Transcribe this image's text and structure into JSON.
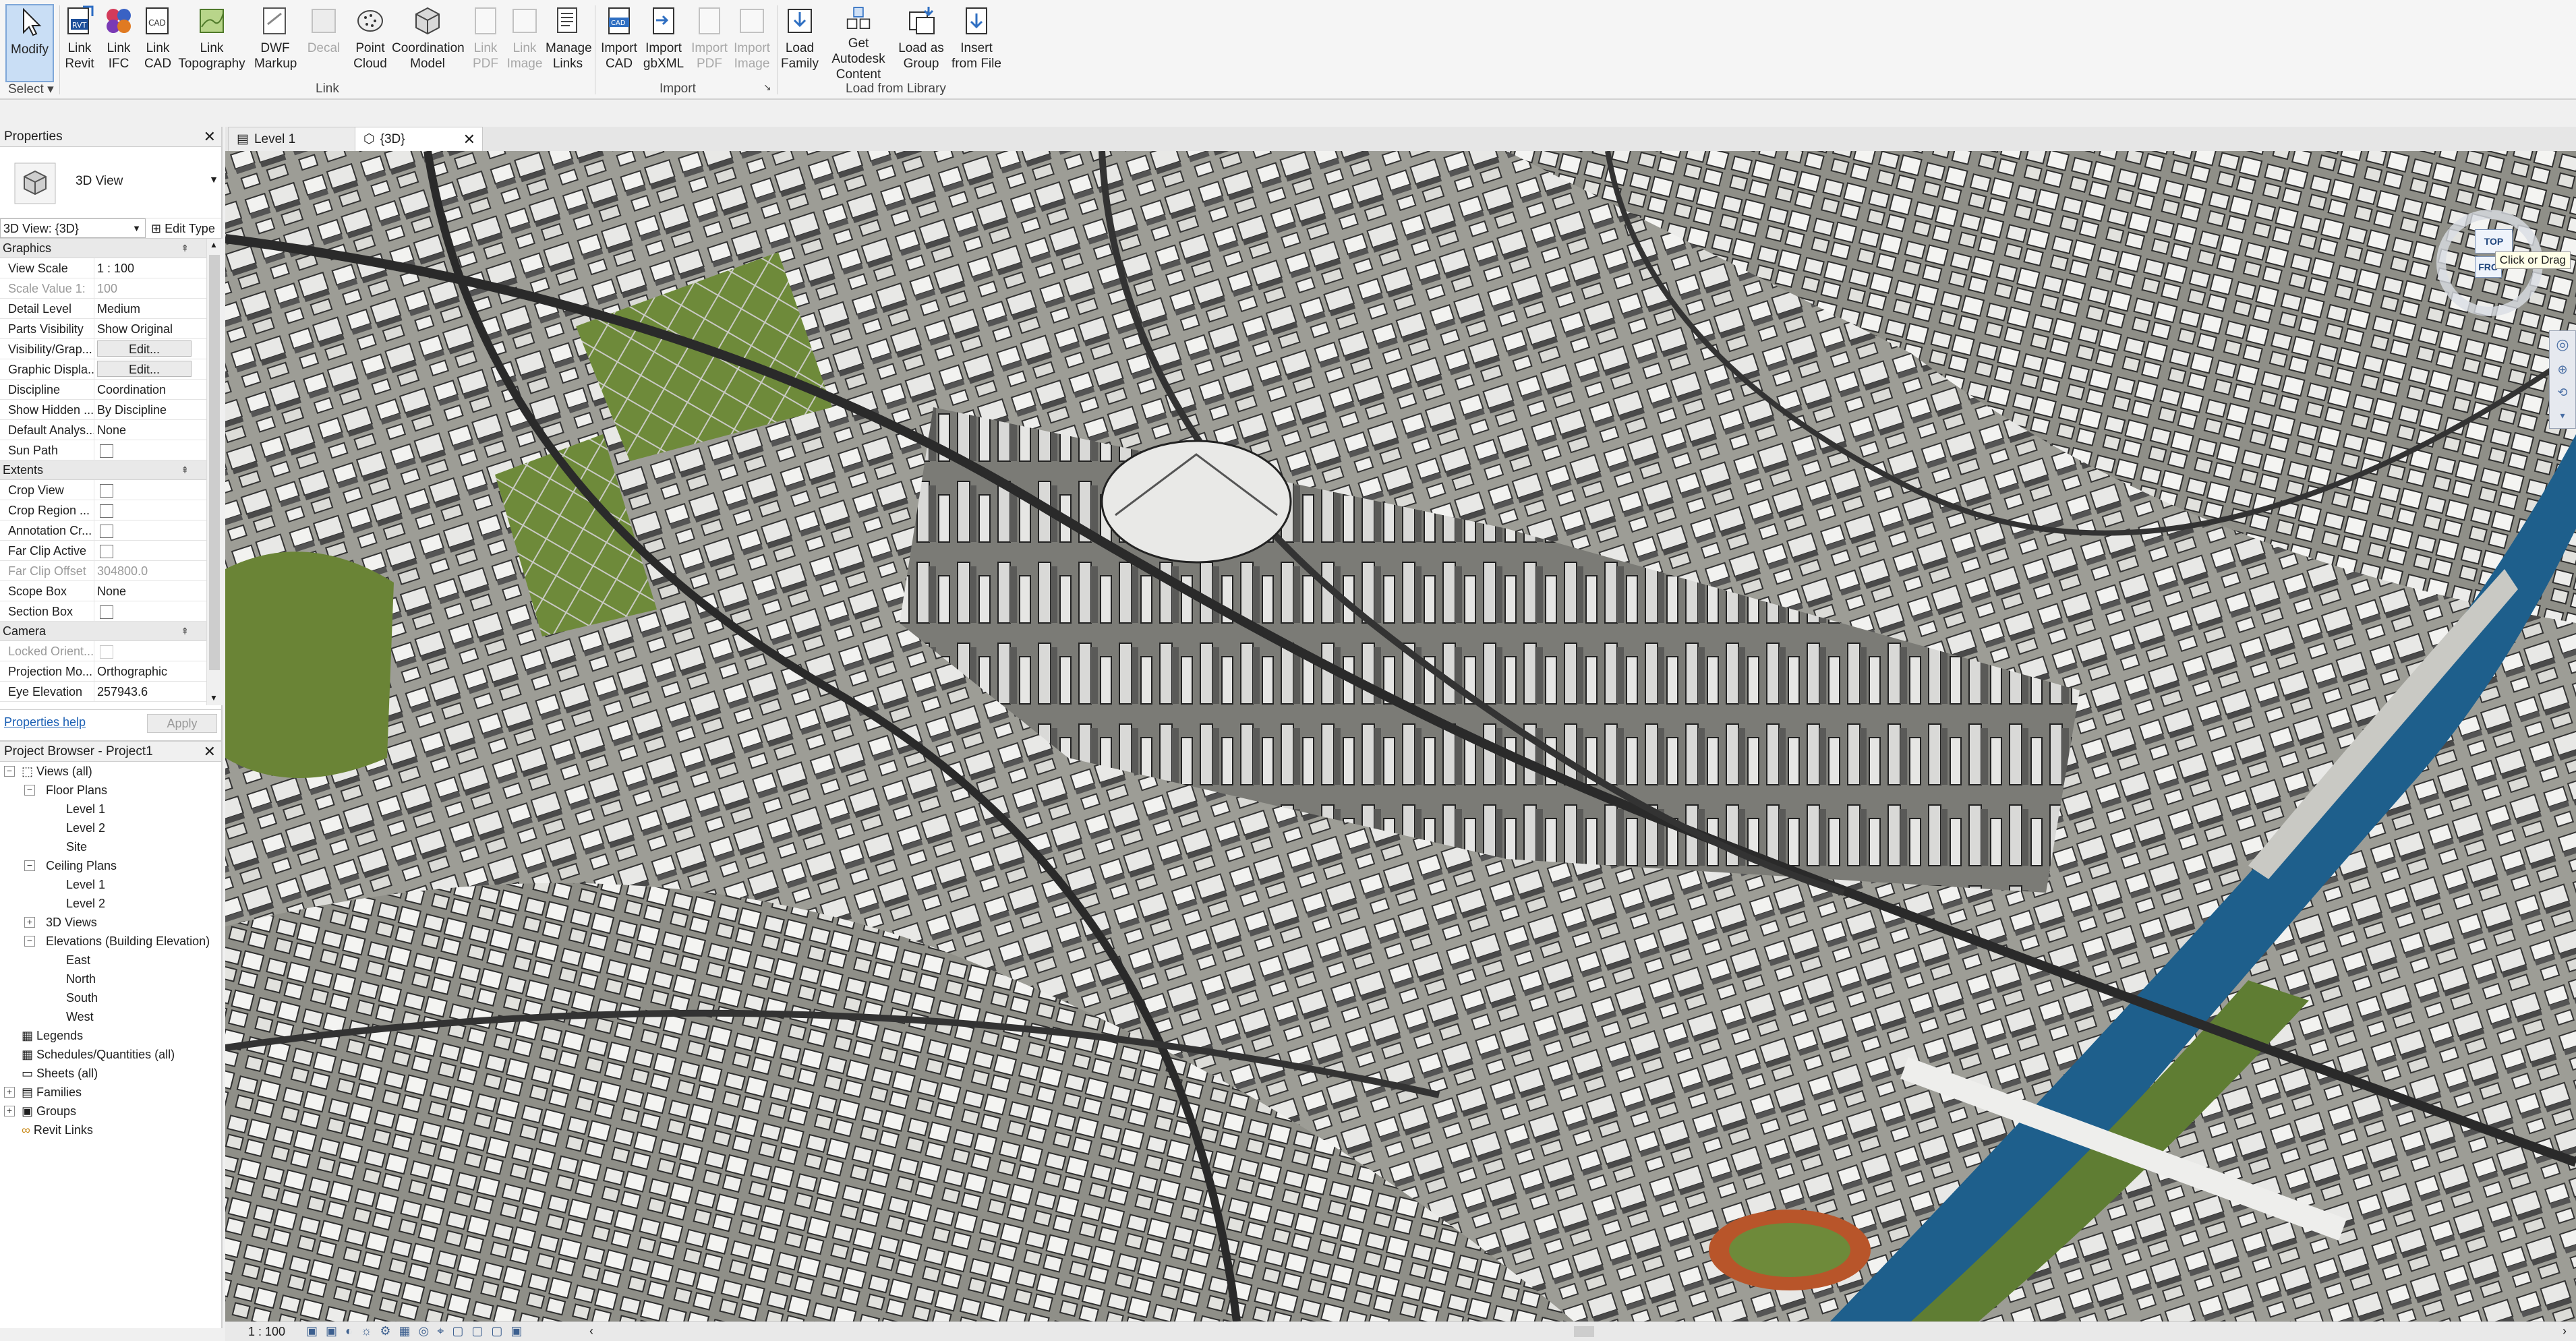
{
  "ribbon": {
    "buttons": {
      "modify": "Modify",
      "link_revit": "Link Revit",
      "link_ifc": "Link IFC",
      "link_cad": "Link CAD",
      "link_topography": "Link Topography",
      "dwf_markup": "DWF Markup",
      "decal": "Decal",
      "point_cloud": "Point Cloud",
      "coordination_model": "Coordination Model",
      "link_pdf": "Link PDF",
      "link_image": "Link Image",
      "manage_links": "Manage Links",
      "import_cad": "Import CAD",
      "import_gbxml": "Import gbXML",
      "import_pdf": "Import PDF",
      "import_image": "Import Image",
      "load_family": "Load Family",
      "get_autodesk_content": "Get Autodesk Content",
      "load_as_group": "Load as Group",
      "insert_from_file": "Insert from File"
    },
    "panels": {
      "select": "Select",
      "link": "Link",
      "import": "Import",
      "load_from_library": "Load from Library"
    }
  },
  "tabs": {
    "level1": "Level 1",
    "view3d": "{3D}"
  },
  "properties": {
    "title": "Properties",
    "type_name": "3D View",
    "instance_selector": "3D View: {3D}",
    "edit_type": "Edit Type",
    "groups": {
      "graphics": "Graphics",
      "extents": "Extents",
      "camera": "Camera"
    },
    "graphics": {
      "view_scale_k": "View Scale",
      "view_scale_v": "1 : 100",
      "scale_value_k": "Scale Value    1:",
      "scale_value_v": "100",
      "detail_level_k": "Detail Level",
      "detail_level_v": "Medium",
      "parts_visibility_k": "Parts Visibility",
      "parts_visibility_v": "Show Original",
      "vg_k": "Visibility/Grap...",
      "vg_v": "Edit...",
      "gd_k": "Graphic Displa...",
      "gd_v": "Edit...",
      "discipline_k": "Discipline",
      "discipline_v": "Coordination",
      "show_hidden_k": "Show Hidden ...",
      "show_hidden_v": "By Discipline",
      "default_analysis_k": "Default Analys...",
      "default_analysis_v": "None",
      "sun_path_k": "Sun Path"
    },
    "extents": {
      "crop_view_k": "Crop View",
      "crop_region_k": "Crop Region ...",
      "annotation_crop_k": "Annotation Cr...",
      "far_clip_active_k": "Far Clip Active",
      "far_clip_offset_k": "Far Clip Offset",
      "far_clip_offset_v": "304800.0",
      "scope_box_k": "Scope Box",
      "scope_box_v": "None",
      "section_box_k": "Section Box"
    },
    "camera": {
      "locked_orient_k": "Locked Orient...",
      "projection_mode_k": "Projection Mo...",
      "projection_mode_v": "Orthographic",
      "eye_elevation_k": "Eye Elevation",
      "eye_elevation_v": "257943.6"
    },
    "help_link": "Properties help",
    "apply": "Apply"
  },
  "browser": {
    "title": "Project Browser - Project1",
    "views_all": "Views (all)",
    "floor_plans": "Floor Plans",
    "fp_items": [
      "Level 1",
      "Level 2",
      "Site"
    ],
    "ceiling_plans": "Ceiling Plans",
    "cp_items": [
      "Level 1",
      "Level 2"
    ],
    "views_3d": "3D Views",
    "elevations": "Elevations (Building Elevation)",
    "el_items": [
      "East",
      "North",
      "South",
      "West"
    ],
    "legends": "Legends",
    "schedules": "Schedules/Quantities (all)",
    "sheets": "Sheets (all)",
    "families": "Families",
    "groups": "Groups",
    "revit_links": "Revit Links"
  },
  "viewcube": {
    "top": "TOP",
    "front": "FRO",
    "tooltip": "Click or Drag"
  },
  "status": {
    "scale": "1 : 100"
  },
  "colors": {
    "accent": "#2f6fc2",
    "river": "#1e5f8c",
    "grass": "#6e8a3a"
  }
}
